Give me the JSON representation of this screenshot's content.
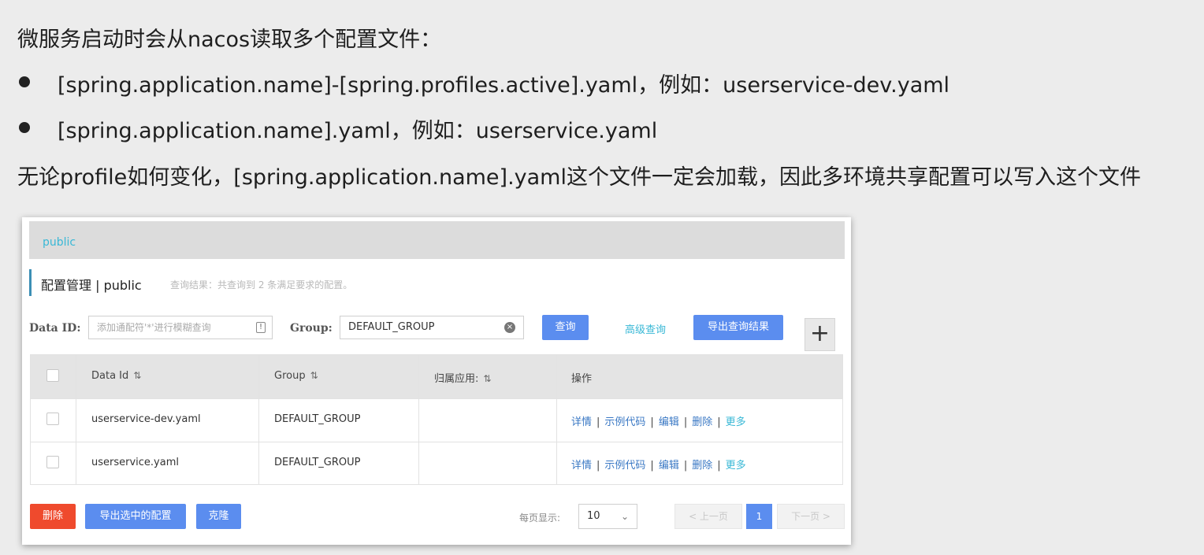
{
  "slide": {
    "heading": "微服务启动时会从nacos读取多个配置文件：",
    "bullets": [
      "[spring.application.name]-[spring.profiles.active].yaml，例如：userservice-dev.yaml",
      "[spring.application.name].yaml，例如：userservice.yaml"
    ],
    "conclusion": "无论profile如何变化，[spring.application.name].yaml这个文件一定会加载，因此多环境共享配置可以写入这个文件"
  },
  "nacos": {
    "namespace_tab": "public",
    "title": "配置管理 | public",
    "result_hint": "查询结果：共查询到 2 条满足要求的配置。",
    "filters": {
      "data_id_label": "Data ID:",
      "data_id_placeholder": "添加通配符'*'进行模糊查询",
      "group_label": "Group:",
      "group_value": "DEFAULT_GROUP",
      "search_button": "查询",
      "advanced_link": "高级查询",
      "export_button": "导出查询结果",
      "add_button": "+"
    },
    "table": {
      "columns": [
        "Data Id",
        "Group",
        "归属应用:",
        "操作"
      ],
      "sort_icon": "⇅",
      "rows": [
        {
          "data_id": "userservice-dev.yaml",
          "group": "DEFAULT_GROUP",
          "app": ""
        },
        {
          "data_id": "userservice.yaml",
          "group": "DEFAULT_GROUP",
          "app": ""
        }
      ],
      "ops": {
        "detail": "详情",
        "sample": "示例代码",
        "edit": "编辑",
        "delete": "删除",
        "more": "更多"
      }
    },
    "footer": {
      "delete_button": "删除",
      "export_selected_button": "导出选中的配置",
      "clone_button": "克隆",
      "page_size_label": "每页显示:",
      "page_size_value": "10",
      "prev": "< 上一页",
      "current_page": "1",
      "next": "下一页 >"
    }
  },
  "colors": {
    "primary": "#5b8def",
    "danger": "#ef4a2d",
    "link": "#3a78c4",
    "accent": "#39b8d6"
  }
}
